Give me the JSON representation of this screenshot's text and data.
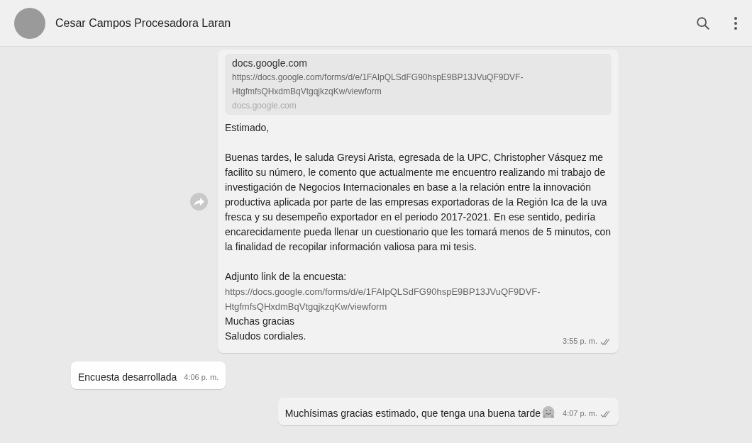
{
  "header": {
    "contact_name": "Cesar Campos Procesadora Laran"
  },
  "messages": [
    {
      "outgoing": true,
      "forward_button": true,
      "link_preview": {
        "title": "docs.google.com",
        "url": "https://docs.google.com/forms/d/e/1FAIpQLSdFG90hspE9BP13JVuQF9DVF-HtgfmfsQHxdmBqVtgqjkzqKw/viewform",
        "domain": "docs.google.com"
      },
      "paragraphs": [
        [
          {
            "kind": "text",
            "text": "Estimado,"
          }
        ],
        [
          {
            "kind": "text",
            "text": "Buenas tardes, le saluda Greysi Arista, egresada de la UPC, Christopher Vásquez me facilito su número, le comento que actualmente me encuentro realizando mi trabajo de investigación de Negocios Internacionales en base a la relación entre la innovación productiva aplicada por parte de las empresas exportadoras de la Región Ica de la uva fresca y su desempeño exportador en el periodo 2017-2021. En ese sentido, pediría encarecidamente pueda llenar un cuestionario que les tomará menos de 5 minutos, con la finalidad de recopilar información valiosa para mi tesis."
          }
        ],
        [
          {
            "kind": "text",
            "text": "Adjunto link de la encuesta:"
          },
          {
            "kind": "link",
            "text": "https://docs.google.com/forms/d/e/1FAIpQLSdFG90hspE9BP13JVuQF9DVF-HtgfmfsQHxdmBqVtgqjkzqKw/viewform"
          },
          {
            "kind": "text",
            "text": "Muchas gracias"
          },
          {
            "kind": "text",
            "text": "Saludos cordiales."
          }
        ]
      ],
      "time": "3:55 p. m.",
      "read": false
    },
    {
      "outgoing": false,
      "paragraphs": [
        [
          {
            "kind": "text",
            "text": "Encuesta desarrollada"
          }
        ]
      ],
      "time": "4:06 p. m."
    },
    {
      "outgoing": true,
      "paragraphs": [
        [
          {
            "kind": "text",
            "text": "Muchísimas gracias estimado, que tenga una buena tarde"
          }
        ]
      ],
      "trailing_emoji": true,
      "time": "4:07 p. m.",
      "read": false
    }
  ]
}
